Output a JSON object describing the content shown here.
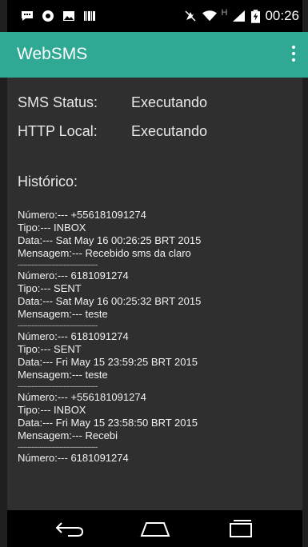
{
  "status_bar": {
    "time": "00:26",
    "network_type": "H",
    "left_icons": [
      "chat-icon",
      "settings-icon",
      "image-icon",
      "barcode-icon"
    ],
    "right_icons": [
      "mute-icon",
      "wifi-icon",
      "signal-icon",
      "battery-icon"
    ]
  },
  "app_bar": {
    "title": "WebSMS",
    "color": "#2fa894"
  },
  "status": {
    "sms_label": "SMS Status:",
    "sms_value": "Executando",
    "http_label": "HTTP Local:",
    "http_value": "Executando"
  },
  "history": {
    "title": "Histórico:",
    "separator": "----------------------------------------",
    "entries": [
      {
        "numero": "Número:--- +556181091274",
        "tipo": "Tipo:--- INBOX",
        "data": "Data:--- Sat May 16 00:26:25 BRT 2015",
        "mensagem": "Mensagem:--- Recebido sms da claro"
      },
      {
        "numero": "Número:--- 6181091274",
        "tipo": "Tipo:--- SENT",
        "data": "Data:--- Sat May 16 00:25:32 BRT 2015",
        "mensagem": "Mensagem:--- teste"
      },
      {
        "numero": "Número:--- 6181091274",
        "tipo": "Tipo:--- SENT",
        "data": "Data:--- Fri May 15 23:59:25 BRT 2015",
        "mensagem": "Mensagem:--- teste"
      },
      {
        "numero": "Número:--- +556181091274",
        "tipo": "Tipo:--- INBOX",
        "data": "Data:--- Fri May 15 23:58:50 BRT 2015",
        "mensagem": "Mensagem:--- Recebi"
      },
      {
        "numero": "Número:--- 6181091274"
      }
    ]
  },
  "nav_bar": {
    "buttons": [
      "back-icon",
      "home-icon",
      "recents-icon"
    ]
  }
}
